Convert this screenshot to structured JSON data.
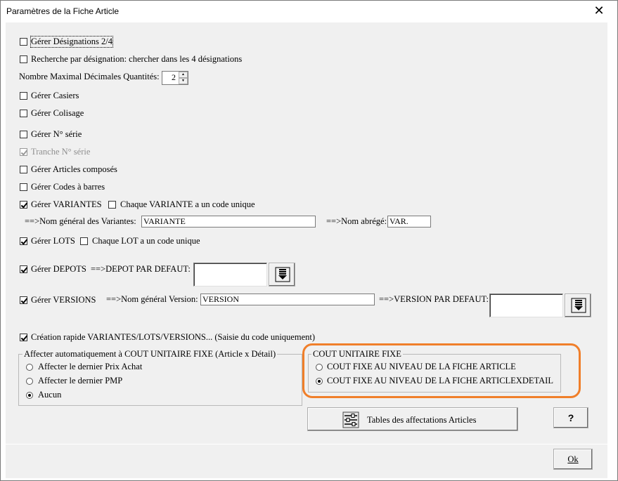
{
  "window": {
    "title": "Paramètres de la Fiche Article",
    "close_glyph": "✕"
  },
  "options": {
    "gerer_designations": {
      "label": "Gérer Désignations 2/4",
      "checked": false
    },
    "recherche_designation": {
      "label": "Recherche par désignation: chercher dans les 4 désignations",
      "checked": false
    },
    "nb_decimales": {
      "label": "Nombre Maximal Décimales Quantités:",
      "value": "2"
    },
    "gerer_casiers": {
      "label": "Gérer Casiers",
      "checked": false
    },
    "gerer_colisage": {
      "label": "Gérer Colisage",
      "checked": false
    },
    "gerer_no_serie": {
      "label": "Gérer N° série",
      "checked": false
    },
    "tranche_no_serie": {
      "label": "Tranche N° série",
      "checked": true,
      "disabled": true
    },
    "gerer_articles_composes": {
      "label": "Gérer Articles composés",
      "checked": false
    },
    "gerer_codes_barres": {
      "label": "Gérer Codes à barres",
      "checked": false
    },
    "gerer_variantes": {
      "label": "Gérer VARIANTES",
      "checked": true
    },
    "variante_code_unique": {
      "label": "Chaque VARIANTE a un code unique",
      "checked": false
    },
    "nom_general_variantes_label": "==>Nom général des Variantes:",
    "nom_general_variantes_value": "VARIANTE",
    "nom_abrege_label": "==>Nom abrégé:",
    "nom_abrege_value": "VAR.",
    "gerer_lots": {
      "label": "Gérer LOTS",
      "checked": true
    },
    "lot_code_unique": {
      "label": "Chaque LOT a un code unique",
      "checked": false
    },
    "gerer_depots": {
      "label": "Gérer DEPOTS",
      "checked": true
    },
    "depot_defaut_label": "==>DEPOT PAR DEFAUT:",
    "depot_defaut_value": "",
    "gerer_versions": {
      "label": "Gérer VERSIONS",
      "checked": true
    },
    "nom_general_version_label": "==>Nom général Version:",
    "nom_general_version_value": "VERSION",
    "version_defaut_label": "==>VERSION PAR DEFAUT:",
    "version_defaut_value": "",
    "creation_rapide": {
      "label": "Création rapide VARIANTES/LOTS/VERSIONS... (Saisie du code uniquement)",
      "checked": true
    }
  },
  "affecter_group": {
    "title": "Affecter automatiquement à COUT UNITAIRE FIXE (Article x Détail)",
    "items": [
      {
        "label": "Affecter le dernier Prix Achat",
        "selected": false
      },
      {
        "label": "Affecter le dernier PMP",
        "selected": false
      },
      {
        "label": "Aucun",
        "selected": true
      }
    ]
  },
  "cout_group": {
    "title": "COUT UNITAIRE FIXE",
    "highlight_color": "#f07f2a",
    "items": [
      {
        "label": "COUT FIXE AU NIVEAU DE LA FICHE ARTICLE",
        "selected": false
      },
      {
        "label": "COUT FIXE AU NIVEAU DE LA FICHE ARTICLEXDETAIL",
        "selected": true
      }
    ]
  },
  "buttons": {
    "tables_affectations": "Tables des affectations Articles",
    "help": "?",
    "ok": "Ok"
  },
  "icons": {
    "spin_up": "▲",
    "spin_down": "▼",
    "lookup": "list-down-arrow-icon",
    "sliders": "sliders-icon"
  }
}
